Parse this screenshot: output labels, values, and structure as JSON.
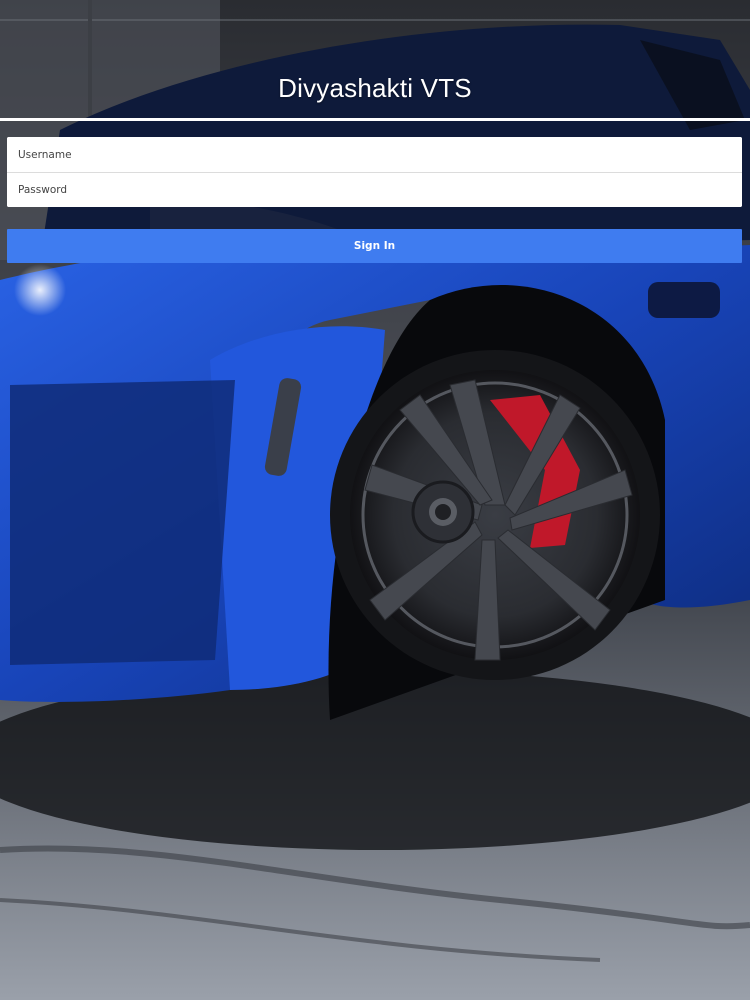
{
  "header": {
    "title": "Divyashakti VTS"
  },
  "login_form": {
    "username": {
      "value": "",
      "placeholder": "Username"
    },
    "password": {
      "value": "",
      "placeholder": "Password"
    },
    "sign_in_label": "Sign In"
  },
  "colors": {
    "accent": "#3f7cf0",
    "title_text": "#ffffff",
    "car_body": "#1c4fc9",
    "brake_caliper": "#c0182a"
  },
  "background": {
    "subject": "blue sports car in dark garage"
  }
}
